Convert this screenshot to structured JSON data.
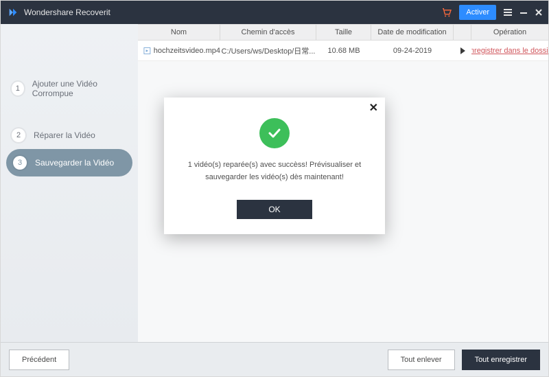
{
  "titlebar": {
    "app_name": "Wondershare Recoverit",
    "activate_label": "Activer"
  },
  "sidebar": {
    "steps": [
      {
        "num": "1",
        "label": "Ajouter une Vidéo Corrompue"
      },
      {
        "num": "2",
        "label": "Réparer la Vidéo"
      },
      {
        "num": "3",
        "label": "Sauvegarder la Vidéo"
      }
    ]
  },
  "table": {
    "headers": {
      "name": "Nom",
      "path": "Chemin d'accès",
      "size": "Taille",
      "date": "Date de modification",
      "operation": "Opération"
    },
    "rows": [
      {
        "name": "hochzeitsvideo.mp4",
        "path": "C:/Users/ws/Desktop/日常...",
        "size": "10.68 MB",
        "date": "09-24-2019",
        "operation": "Enregistrer dans le dossier"
      }
    ]
  },
  "footer": {
    "prev": "Précédent",
    "remove_all": "Tout enlever",
    "save_all": "Tout enregistrer"
  },
  "modal": {
    "message": "1 vidéo(s) reparée(s) avec succèss! Prévisualiser et sauvegarder les vidéo(s) dès maintenant!",
    "ok": "OK"
  }
}
